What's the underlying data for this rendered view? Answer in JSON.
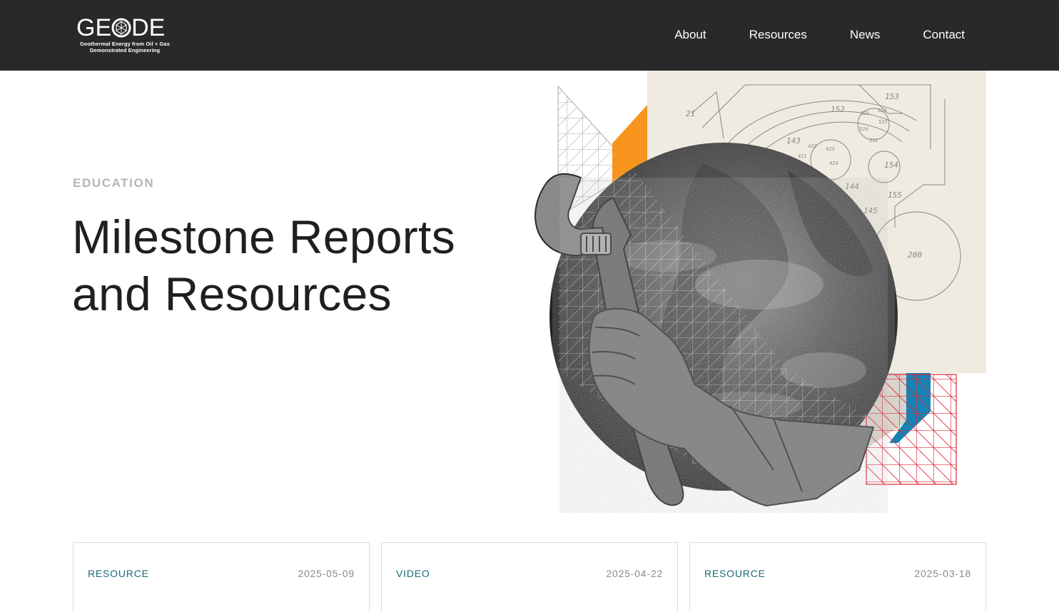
{
  "brand": {
    "wordmark": "GE",
    "wordmark_tail": "DE",
    "tagline_line1": "Geothermal Energy from Oil + Gas",
    "tagline_line2": "Demonstrated Engineering"
  },
  "nav": {
    "items": [
      {
        "label": "About"
      },
      {
        "label": "Resources"
      },
      {
        "label": "News"
      },
      {
        "label": "Contact"
      }
    ]
  },
  "hero": {
    "eyebrow": "EDUCATION",
    "title_line1": "Milestone Reports",
    "title_line2": "and Resources",
    "illustration_icons": [
      "globe",
      "wrench",
      "gloved-hand",
      "blueprint",
      "grid"
    ]
  },
  "blueprint_labels": [
    "21",
    "143",
    "152",
    "153",
    "154",
    "155",
    "145",
    "144",
    "200",
    "421",
    "422",
    "423",
    "424",
    "521",
    "522",
    "523",
    "524",
    "531"
  ],
  "cards": [
    {
      "tag": "RESOURCE",
      "date": "2025-05-09"
    },
    {
      "tag": "VIDEO",
      "date": "2025-04-22"
    },
    {
      "tag": "RESOURCE",
      "date": "2025-03-18"
    }
  ],
  "colors": {
    "header_bg": "#262626",
    "accent_orange": "#f7941d",
    "accent_blue": "#1583b5",
    "accent_red": "#e0283a",
    "tag_teal": "#1b6a78",
    "blueprint_paper": "#efebe0"
  }
}
